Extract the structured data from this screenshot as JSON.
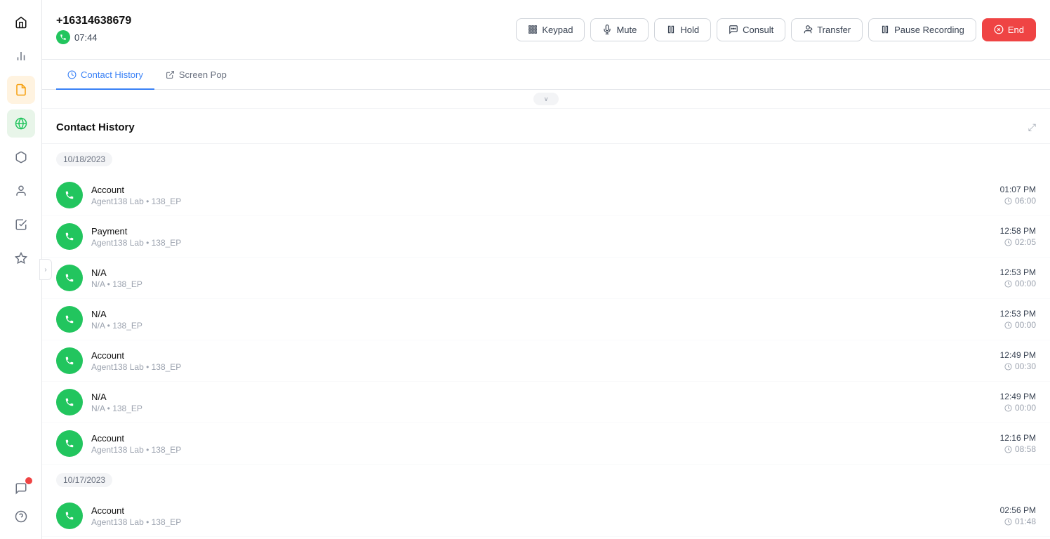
{
  "sidebar": {
    "items": [
      {
        "name": "home",
        "icon": "⌂",
        "active": true,
        "badge": false
      },
      {
        "name": "analytics",
        "icon": "📊",
        "active": false,
        "badge": false
      },
      {
        "name": "notes",
        "icon": "📋",
        "active": false,
        "badge": false
      },
      {
        "name": "globe",
        "icon": "🌐",
        "active": false,
        "badge": false
      },
      {
        "name": "box",
        "icon": "📦",
        "active": false,
        "badge": false
      },
      {
        "name": "users",
        "icon": "👤",
        "active": false,
        "badge": false
      },
      {
        "name": "tasks",
        "icon": "📋",
        "active": false,
        "badge": false
      },
      {
        "name": "star",
        "icon": "★",
        "active": false,
        "badge": false
      }
    ],
    "bottomItems": [
      {
        "name": "chat",
        "icon": "💬",
        "badge": true
      },
      {
        "name": "help",
        "icon": "❓",
        "badge": false
      }
    ]
  },
  "topbar": {
    "phoneNumber": "+16314638679",
    "timer": "07:44",
    "buttons": {
      "keypad": "Keypad",
      "mute": "Mute",
      "hold": "Hold",
      "consult": "Consult",
      "transfer": "Transfer",
      "pauseRecording": "Pause Recording",
      "end": "End"
    }
  },
  "tabs": [
    {
      "label": "Contact History",
      "active": true,
      "icon": "🕐"
    },
    {
      "label": "Screen Pop",
      "active": false,
      "icon": "↗"
    }
  ],
  "contactHistory": {
    "title": "Contact History",
    "groups": [
      {
        "date": "10/18/2023",
        "items": [
          {
            "name": "Account",
            "sub": "Agent138 Lab • 138_EP",
            "time": "01:07 PM",
            "duration": "06:00"
          },
          {
            "name": "Payment",
            "sub": "Agent138 Lab • 138_EP",
            "time": "12:58 PM",
            "duration": "02:05"
          },
          {
            "name": "N/A",
            "sub": "N/A • 138_EP",
            "time": "12:53 PM",
            "duration": "00:00"
          },
          {
            "name": "N/A",
            "sub": "N/A • 138_EP",
            "time": "12:53 PM",
            "duration": "00:00"
          },
          {
            "name": "Account",
            "sub": "Agent138 Lab • 138_EP",
            "time": "12:49 PM",
            "duration": "00:30"
          },
          {
            "name": "N/A",
            "sub": "N/A • 138_EP",
            "time": "12:49 PM",
            "duration": "00:00"
          },
          {
            "name": "Account",
            "sub": "Agent138 Lab • 138_EP",
            "time": "12:16 PM",
            "duration": "08:58"
          }
        ]
      },
      {
        "date": "10/17/2023",
        "items": [
          {
            "name": "Account",
            "sub": "Agent138 Lab • 138_EP",
            "time": "02:56 PM",
            "duration": "01:48"
          }
        ]
      }
    ]
  },
  "colors": {
    "accent": "#3b82f6",
    "green": "#22c55e",
    "red": "#ef4444"
  }
}
